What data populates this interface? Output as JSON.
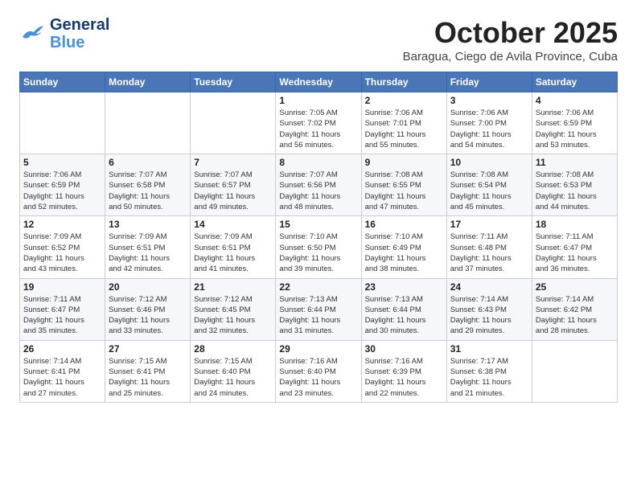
{
  "header": {
    "logo_line1": "General",
    "logo_line2": "Blue",
    "month": "October 2025",
    "location": "Baragua, Ciego de Avila Province, Cuba"
  },
  "days_of_week": [
    "Sunday",
    "Monday",
    "Tuesday",
    "Wednesday",
    "Thursday",
    "Friday",
    "Saturday"
  ],
  "weeks": [
    [
      {
        "day": "",
        "info": ""
      },
      {
        "day": "",
        "info": ""
      },
      {
        "day": "",
        "info": ""
      },
      {
        "day": "1",
        "info": "Sunrise: 7:05 AM\nSunset: 7:02 PM\nDaylight: 11 hours\nand 56 minutes."
      },
      {
        "day": "2",
        "info": "Sunrise: 7:06 AM\nSunset: 7:01 PM\nDaylight: 11 hours\nand 55 minutes."
      },
      {
        "day": "3",
        "info": "Sunrise: 7:06 AM\nSunset: 7:00 PM\nDaylight: 11 hours\nand 54 minutes."
      },
      {
        "day": "4",
        "info": "Sunrise: 7:06 AM\nSunset: 6:59 PM\nDaylight: 11 hours\nand 53 minutes."
      }
    ],
    [
      {
        "day": "5",
        "info": "Sunrise: 7:06 AM\nSunset: 6:59 PM\nDaylight: 11 hours\nand 52 minutes."
      },
      {
        "day": "6",
        "info": "Sunrise: 7:07 AM\nSunset: 6:58 PM\nDaylight: 11 hours\nand 50 minutes."
      },
      {
        "day": "7",
        "info": "Sunrise: 7:07 AM\nSunset: 6:57 PM\nDaylight: 11 hours\nand 49 minutes."
      },
      {
        "day": "8",
        "info": "Sunrise: 7:07 AM\nSunset: 6:56 PM\nDaylight: 11 hours\nand 48 minutes."
      },
      {
        "day": "9",
        "info": "Sunrise: 7:08 AM\nSunset: 6:55 PM\nDaylight: 11 hours\nand 47 minutes."
      },
      {
        "day": "10",
        "info": "Sunrise: 7:08 AM\nSunset: 6:54 PM\nDaylight: 11 hours\nand 45 minutes."
      },
      {
        "day": "11",
        "info": "Sunrise: 7:08 AM\nSunset: 6:53 PM\nDaylight: 11 hours\nand 44 minutes."
      }
    ],
    [
      {
        "day": "12",
        "info": "Sunrise: 7:09 AM\nSunset: 6:52 PM\nDaylight: 11 hours\nand 43 minutes."
      },
      {
        "day": "13",
        "info": "Sunrise: 7:09 AM\nSunset: 6:51 PM\nDaylight: 11 hours\nand 42 minutes."
      },
      {
        "day": "14",
        "info": "Sunrise: 7:09 AM\nSunset: 6:51 PM\nDaylight: 11 hours\nand 41 minutes."
      },
      {
        "day": "15",
        "info": "Sunrise: 7:10 AM\nSunset: 6:50 PM\nDaylight: 11 hours\nand 39 minutes."
      },
      {
        "day": "16",
        "info": "Sunrise: 7:10 AM\nSunset: 6:49 PM\nDaylight: 11 hours\nand 38 minutes."
      },
      {
        "day": "17",
        "info": "Sunrise: 7:11 AM\nSunset: 6:48 PM\nDaylight: 11 hours\nand 37 minutes."
      },
      {
        "day": "18",
        "info": "Sunrise: 7:11 AM\nSunset: 6:47 PM\nDaylight: 11 hours\nand 36 minutes."
      }
    ],
    [
      {
        "day": "19",
        "info": "Sunrise: 7:11 AM\nSunset: 6:47 PM\nDaylight: 11 hours\nand 35 minutes."
      },
      {
        "day": "20",
        "info": "Sunrise: 7:12 AM\nSunset: 6:46 PM\nDaylight: 11 hours\nand 33 minutes."
      },
      {
        "day": "21",
        "info": "Sunrise: 7:12 AM\nSunset: 6:45 PM\nDaylight: 11 hours\nand 32 minutes."
      },
      {
        "day": "22",
        "info": "Sunrise: 7:13 AM\nSunset: 6:44 PM\nDaylight: 11 hours\nand 31 minutes."
      },
      {
        "day": "23",
        "info": "Sunrise: 7:13 AM\nSunset: 6:44 PM\nDaylight: 11 hours\nand 30 minutes."
      },
      {
        "day": "24",
        "info": "Sunrise: 7:14 AM\nSunset: 6:43 PM\nDaylight: 11 hours\nand 29 minutes."
      },
      {
        "day": "25",
        "info": "Sunrise: 7:14 AM\nSunset: 6:42 PM\nDaylight: 11 hours\nand 28 minutes."
      }
    ],
    [
      {
        "day": "26",
        "info": "Sunrise: 7:14 AM\nSunset: 6:41 PM\nDaylight: 11 hours\nand 27 minutes."
      },
      {
        "day": "27",
        "info": "Sunrise: 7:15 AM\nSunset: 6:41 PM\nDaylight: 11 hours\nand 25 minutes."
      },
      {
        "day": "28",
        "info": "Sunrise: 7:15 AM\nSunset: 6:40 PM\nDaylight: 11 hours\nand 24 minutes."
      },
      {
        "day": "29",
        "info": "Sunrise: 7:16 AM\nSunset: 6:40 PM\nDaylight: 11 hours\nand 23 minutes."
      },
      {
        "day": "30",
        "info": "Sunrise: 7:16 AM\nSunset: 6:39 PM\nDaylight: 11 hours\nand 22 minutes."
      },
      {
        "day": "31",
        "info": "Sunrise: 7:17 AM\nSunset: 6:38 PM\nDaylight: 11 hours\nand 21 minutes."
      },
      {
        "day": "",
        "info": ""
      }
    ]
  ]
}
